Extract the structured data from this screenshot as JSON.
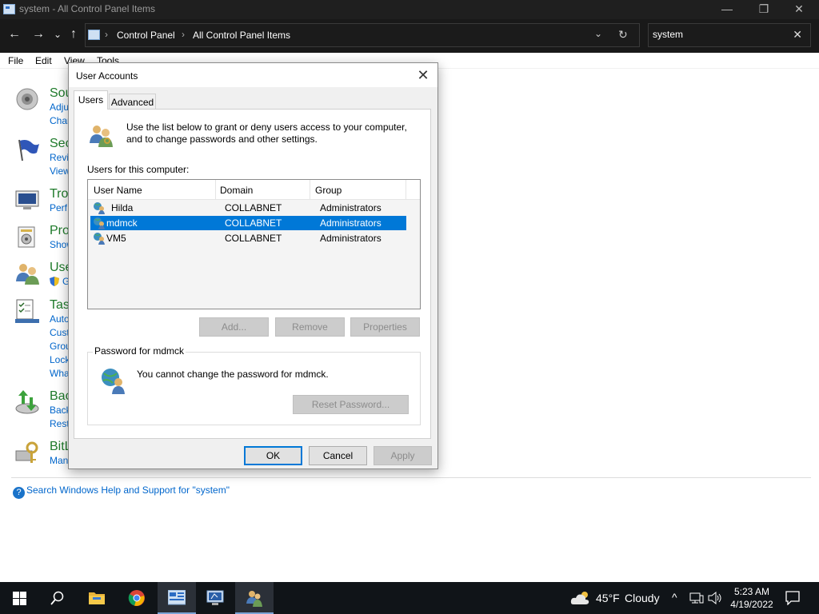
{
  "window": {
    "title": "system - All Control Panel Items",
    "minimize": "—",
    "restore": "❐",
    "close": "✕"
  },
  "address_bar": {
    "back": "←",
    "forward": "→",
    "recent": "⌄",
    "up": "↑",
    "crumbs": [
      "Control Panel",
      "All Control Panel Items"
    ],
    "separator": "›",
    "dropdown": "⌄",
    "refresh": "↻"
  },
  "search": {
    "value": "system",
    "clear": "✕"
  },
  "menu": [
    "File",
    "Edit",
    "View",
    "Tools"
  ],
  "background_items": [
    {
      "title": "Sou",
      "links": [
        "Adju",
        "Char"
      ]
    },
    {
      "title": "Sec",
      "links": [
        "Revi",
        "View"
      ]
    },
    {
      "title": "Trou",
      "links": [
        "Perf"
      ]
    },
    {
      "title": "Pro",
      "links": [
        "Show"
      ]
    },
    {
      "title": "Use",
      "links": [
        "G"
      ]
    },
    {
      "title": "Tasl",
      "links": [
        "Auto",
        "Cust",
        "Grou",
        "Lock",
        "Wha"
      ]
    },
    {
      "title": "Bac",
      "links": [
        "Back",
        "Rest"
      ]
    },
    {
      "title": "BitL",
      "links": [
        "Man"
      ]
    }
  ],
  "help_link": "Search Windows Help and Support for \"system\"",
  "dialog": {
    "title": "User Accounts",
    "close": "✕",
    "tabs": [
      "Users",
      "Advanced"
    ],
    "intro": "Use the list below to grant or deny users access to your computer, and to change passwords and other settings.",
    "users_label": "Users for this computer:",
    "columns": [
      "User Name",
      "Domain",
      "Group"
    ],
    "rows": [
      {
        "name": "Hilda",
        "domain": "COLLABNET",
        "group": "Administrators"
      },
      {
        "name": "mdmck",
        "domain": "COLLABNET",
        "group": "Administrators"
      },
      {
        "name": "VM5",
        "domain": "COLLABNET",
        "group": "Administrators"
      }
    ],
    "selected_row": "mdmck",
    "buttons": {
      "add": "Add...",
      "remove": "Remove",
      "properties": "Properties"
    },
    "password_group": {
      "legend": "Password for mdmck",
      "message": "You cannot change the password for mdmck.",
      "reset": "Reset Password..."
    },
    "footer": {
      "ok": "OK",
      "cancel": "Cancel",
      "apply": "Apply"
    }
  },
  "taskbar": {
    "weather": {
      "temp": "45°F",
      "condition": "Cloudy"
    },
    "time": "5:23 AM",
    "date": "4/19/2022",
    "tray_chevron": "^"
  }
}
